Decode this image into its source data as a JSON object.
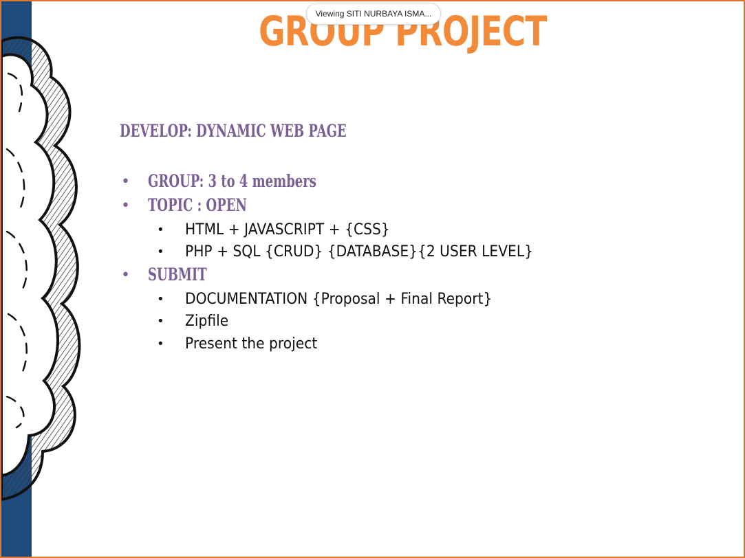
{
  "share_banner": {
    "text": "Viewing SITI NURBAYA ISMA..."
  },
  "slide": {
    "title": "GROUP PROJECT",
    "heading": "DEVELOP: DYNAMIC WEB PAGE",
    "items": [
      {
        "label": "GROUP: 3 to 4 members",
        "subitems": []
      },
      {
        "label": "TOPIC : OPEN",
        "subitems": [
          "HTML + JAVASCRIPT + {CSS}",
          "PHP + SQL {CRUD} {DATABASE}{2 USER LEVEL}"
        ]
      },
      {
        "label": "SUBMIT",
        "subitems": [
          "DOCUMENTATION {Proposal + Final Report}",
          "Zipfile",
          "Present the project"
        ]
      }
    ],
    "bullet_glyph": "•",
    "colors": {
      "title": "#f28a3a",
      "accent": "#7a5f96",
      "band": "#1f4a7c",
      "frame": "#e0762a"
    }
  }
}
